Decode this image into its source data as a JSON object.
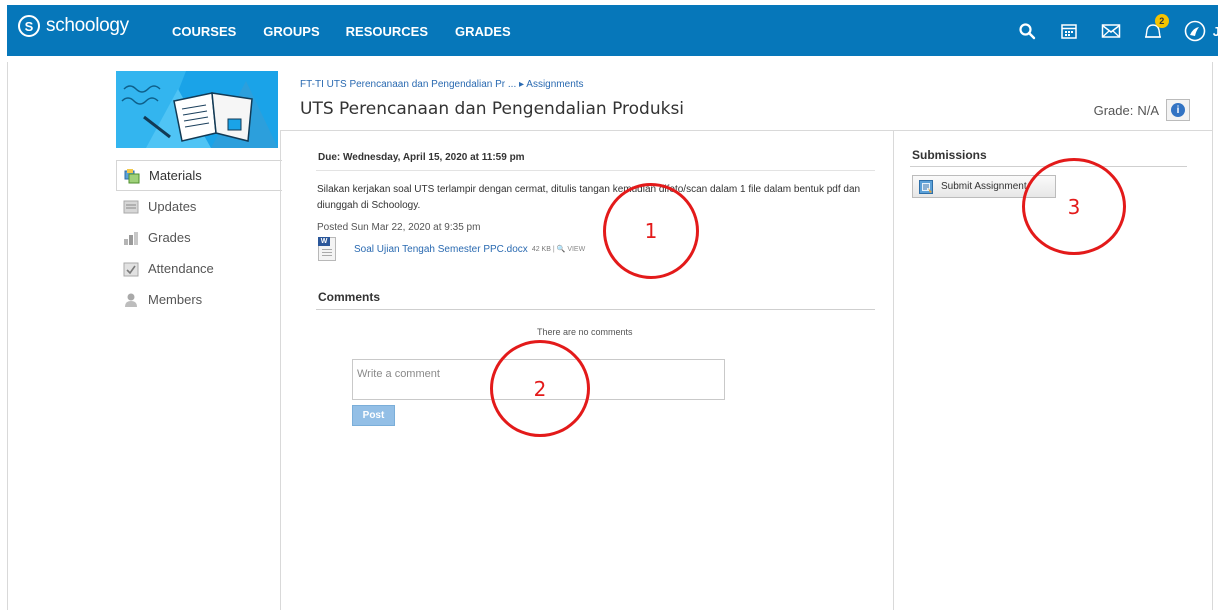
{
  "nav": {
    "logo_text": "schoology",
    "logo_mark": "S",
    "links": [
      "COURSES",
      "GROUPS",
      "RESOURCES",
      "GRADES"
    ],
    "icons": [
      "search-icon",
      "calendar-icon",
      "mail-icon",
      "notifications-icon",
      "user-avatar-icon"
    ],
    "notification_count": "2",
    "user_initial": "J"
  },
  "sidebar": {
    "items": [
      {
        "label": "Materials",
        "icon": "materials-icon",
        "active": true
      },
      {
        "label": "Updates",
        "icon": "updates-icon"
      },
      {
        "label": "Grades",
        "icon": "grades-icon"
      },
      {
        "label": "Attendance",
        "icon": "attendance-icon"
      },
      {
        "label": "Members",
        "icon": "members-icon"
      }
    ]
  },
  "breadcrumb": {
    "course": "FT-TI UTS Perencanaan dan Pengendalian Pr ...",
    "separator": "▸",
    "section": "Assignments"
  },
  "assignment": {
    "title": "UTS Perencanaan dan Pengendalian Produksi",
    "grade_label": "Grade:",
    "grade_value": "N/A",
    "due": "Due: Wednesday, April 15, 2020 at 11:59 pm",
    "description": "Silakan kerjakan soal UTS terlampir dengan cermat, ditulis tangan kemudian difoto/scan dalam 1 file dalam bentuk pdf dan diunggah di Schoology.",
    "posted": "Posted Sun Mar 22, 2020 at 9:35 pm",
    "attachment": {
      "name": "Soal Ujian Tengah Semester PPC.docx",
      "size": "42 KB",
      "view": "| 🔍 VIEW"
    }
  },
  "comments": {
    "heading": "Comments",
    "empty_text": "There are no comments",
    "placeholder": "Write a comment",
    "post_label": "Post"
  },
  "submissions": {
    "heading": "Submissions",
    "button_label": "Submit Assignment"
  },
  "annotations": [
    "1",
    "2",
    "3"
  ],
  "colors": {
    "nav_bg": "#0677ba",
    "link": "#2a6ab1",
    "annotation": "#e31a1a",
    "course_pic": "#1aa3e8"
  }
}
